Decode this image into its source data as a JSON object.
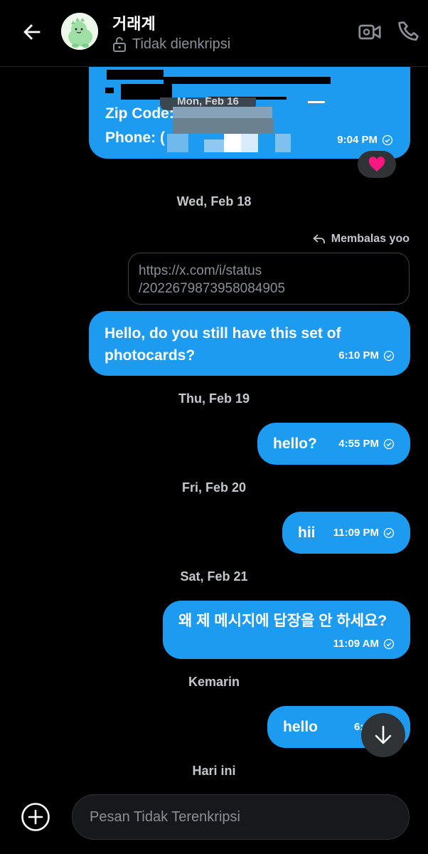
{
  "header": {
    "name": "거래계",
    "encryption_status": "Tidak dienkripsi"
  },
  "messages": {
    "m0": {
      "line1": "Zip Code:",
      "line2": "Phone: (",
      "overlay_date": "Mon, Feb 16",
      "time": "9:04 PM",
      "reaction": "heart"
    },
    "d1": "Wed, Feb 18",
    "reply": {
      "label": "Membalas yoo",
      "quoted_line1": "https://x.com/i/status",
      "quoted_line2": "/2022679873958084905"
    },
    "m1": {
      "line1": "Hello, do you still have this set of",
      "line2": "photocards?",
      "time": "6:10 PM"
    },
    "d2": "Thu, Feb 19",
    "m2": {
      "text": "hello?",
      "time": "4:55 PM"
    },
    "d3": "Fri, Feb 20",
    "m3": {
      "text": "hii",
      "time": "11:09 PM"
    },
    "d4": "Sat, Feb 21",
    "m4": {
      "text": "왜 제 메시지에 답장을 안 하세요?",
      "time": "11:09 AM"
    },
    "d5": "Kemarin",
    "m5": {
      "text": "hello",
      "time": "6:12 AM"
    },
    "d6": "Hari ini"
  },
  "composer": {
    "placeholder": "Pesan Tidak Terenkripsi"
  },
  "colors": {
    "accent": "#1d9bf0",
    "background": "#000000",
    "muted": "#8b8f95",
    "reaction_heart": "#f91880"
  }
}
